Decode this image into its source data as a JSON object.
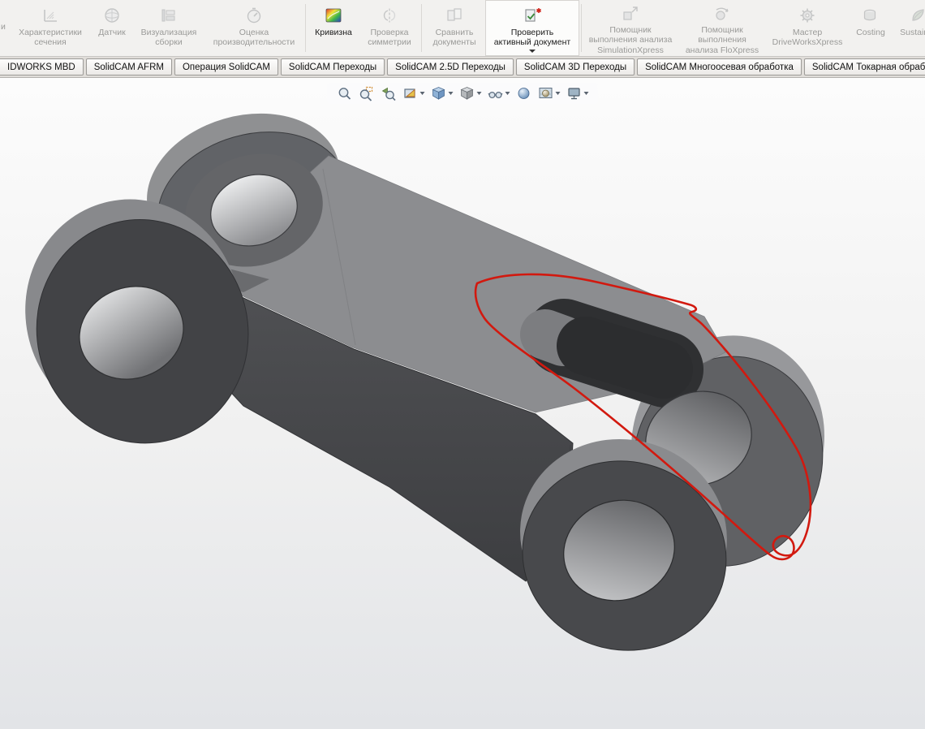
{
  "colors": {
    "annotation": "#d2190f",
    "model_top_face": "#8c8d90",
    "model_front_face": "#454649",
    "viewport_top": "#fcfcfc",
    "viewport_bottom": "#e2e4e7"
  },
  "ribbon": {
    "cutoff_label": "и",
    "buttons": [
      {
        "id": "section-properties",
        "label": "Характеристики\nсечения",
        "enabled": false
      },
      {
        "id": "sensor",
        "label": "Датчик",
        "enabled": false
      },
      {
        "id": "assembly-visualization",
        "label": "Визуализация\nсборки",
        "enabled": false
      },
      {
        "id": "performance-evaluation",
        "label": "Оценка\nпроизводительности",
        "enabled": false
      },
      {
        "id": "curvature",
        "label": "Кривизна",
        "enabled": true
      },
      {
        "id": "symmetry-check",
        "label": "Проверка\nсимметрии",
        "enabled": false
      },
      {
        "id": "compare-documents",
        "label": "Сравнить\nдокументы",
        "enabled": false
      },
      {
        "id": "check-active-document",
        "label": "Проверить\nактивный документ",
        "enabled": true,
        "dropdown": true
      },
      {
        "id": "simulationxpress",
        "label": "Помощник\nвыполнения анализа\nSimulationXpress",
        "enabled": false
      },
      {
        "id": "floxpress",
        "label": "Помощник\nвыполнения\nанализа FloXpress",
        "enabled": false
      },
      {
        "id": "driveworksxpress",
        "label": "Мастер\nDriveWorksXpress",
        "enabled": false
      },
      {
        "id": "costing",
        "label": "Costing",
        "enabled": false
      },
      {
        "id": "sustainability",
        "label": "Sustainat",
        "enabled": false
      }
    ]
  },
  "tabs": [
    {
      "label": "IDWORKS MBD"
    },
    {
      "label": "SolidCAM AFRM"
    },
    {
      "label": "Операция  SolidCAM"
    },
    {
      "label": "SolidCAM Переходы"
    },
    {
      "label": "SolidCAM 2.5D Переходы"
    },
    {
      "label": "SolidCAM 3D Переходы"
    },
    {
      "label": "SolidCAM Многоосевая обработка"
    },
    {
      "label": "SolidCAM Токарная обработка"
    }
  ],
  "hud": {
    "icons": [
      "zoom-fit",
      "zoom-area",
      "previous-view",
      "section-view",
      "view-orientation",
      "display-style",
      "hide-show-items",
      "edit-appearance",
      "apply-scene",
      "view-settings"
    ]
  },
  "scene": {
    "description": "Gray 3D clevis chain-link part in isometric view with red freehand annotation loop around right fork"
  }
}
